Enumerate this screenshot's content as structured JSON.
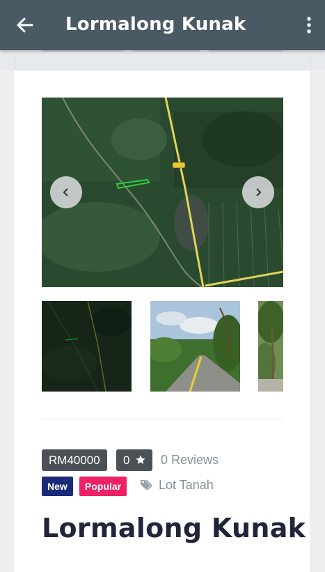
{
  "appbar": {
    "title": "Lormalong Kunak",
    "back_icon": "arrow-left-icon",
    "menu_icon": "more-vertical-icon"
  },
  "gallery": {
    "main_image": "satellite-map-image",
    "prev_icon": "chevron-left-icon",
    "next_icon": "chevron-right-icon",
    "thumbnails": [
      "satellite-map-thumbnail",
      "rural-road-photo-thumbnail",
      "palm-trees-photo-thumbnail"
    ]
  },
  "listing": {
    "price": "RM40000",
    "rating": "0",
    "rating_icon": "star-icon",
    "reviews": "0 Reviews",
    "badges": [
      {
        "label": "New",
        "color": "#1b2a78"
      },
      {
        "label": "Popular",
        "color": "#ee2167"
      }
    ],
    "category_icon": "tags-icon",
    "category": "Lot Tanah",
    "title": "Lormalong Kunak"
  },
  "colors": {
    "appbar": "#4a5a64",
    "badge_dark": "#4b5157",
    "heading": "#22253a",
    "muted_text": "#8a9099"
  }
}
